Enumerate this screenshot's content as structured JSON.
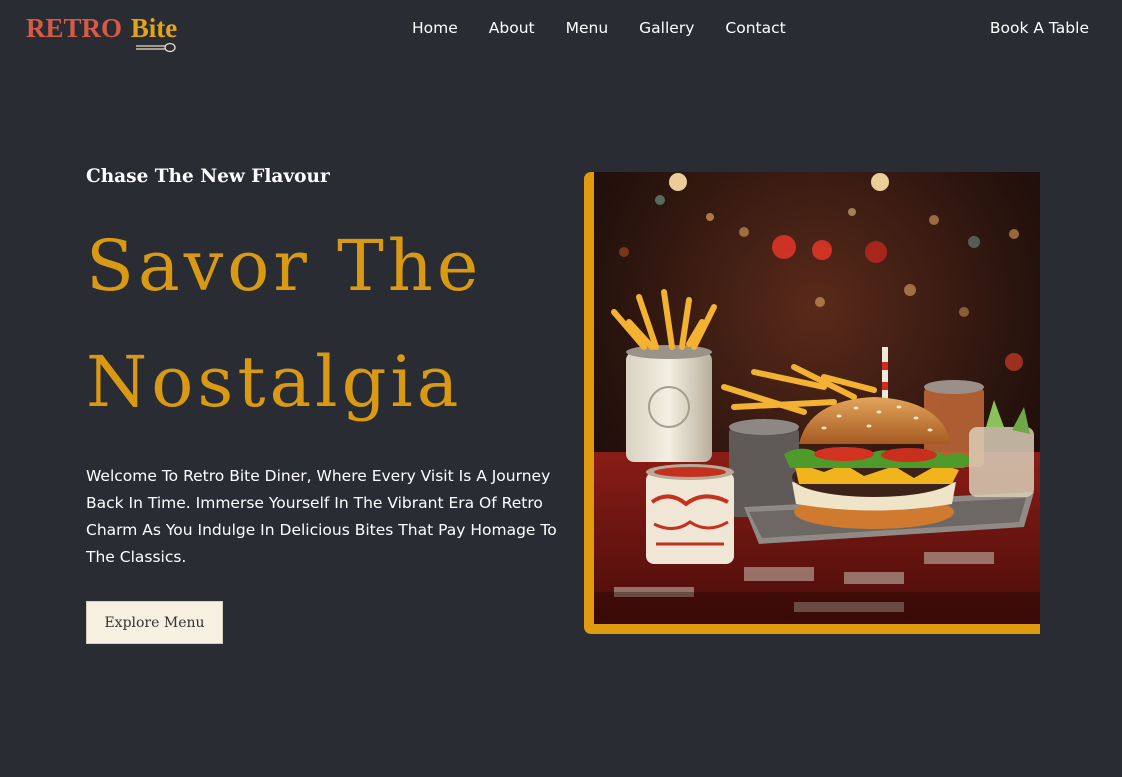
{
  "header": {
    "logo": {
      "word1": "RETRO",
      "word2": "Bite"
    },
    "nav": [
      "Home",
      "About",
      "Menu",
      "Gallery",
      "Contact"
    ],
    "cta": "Book A Table"
  },
  "hero": {
    "tagline": "Chase The New Flavour",
    "headline_line1": "Savor The",
    "headline_line2": "Nostalgia",
    "intro": "Welcome To Retro Bite Diner, Where Every Visit Is A Journey Back In Time. Immerse Yourself In The Vibrant Era Of Retro Charm As You Indulge In Delicious Bites That Pay Homage To The Classics.",
    "button": "Explore Menu"
  },
  "colors": {
    "background": "#292d33",
    "accent": "#d99914",
    "logo_red": "#d65a45",
    "logo_gold": "#e3a41c",
    "button_bg": "#f7efe0"
  },
  "icons": {
    "logo_mark": "spoon-icon",
    "hero_image": "burger-and-fries-diner-photo"
  }
}
